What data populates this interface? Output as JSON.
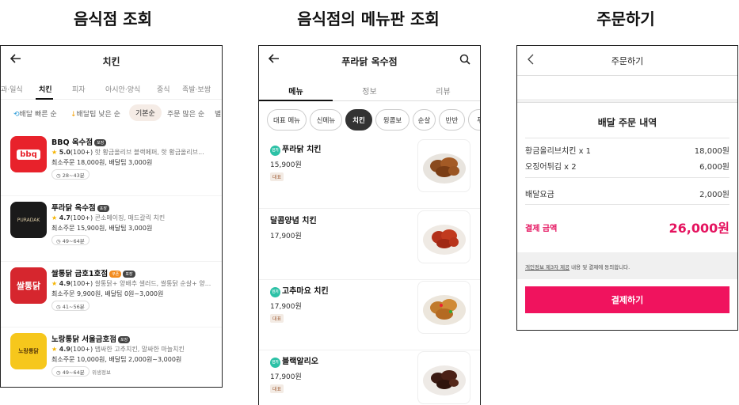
{
  "headings": {
    "search": "음식점 조회",
    "menu": "음식점의 메뉴판 조회",
    "order": "주문하기"
  },
  "search_panel": {
    "back_icon": "back-arrow-icon",
    "title": "치킨",
    "categories": [
      "과·일식",
      "치킨",
      "피자",
      "아시안·양식",
      "중식",
      "족발·보쌈"
    ],
    "active_category": "치킨",
    "sorts": [
      "배달 빠른 순",
      "배달팁 낮은 순",
      "기본순",
      "주문 많은 순",
      "별"
    ],
    "active_sort": "기본순",
    "stores": [
      {
        "name": "BBQ 옥수점",
        "tags": [
          "포장"
        ],
        "rating": "5.0",
        "reviews": "(100+)",
        "desc": "핫 황금올리브 블랙페퍼, 핫 황금올리브...",
        "min_order": "최소주문 18,000원, 배달팁 3,000원",
        "time": "28~43분",
        "logo_text": "bbq"
      },
      {
        "name": "푸라닭 옥수점",
        "tags": [
          "포장"
        ],
        "rating": "4.7",
        "reviews": "(100+)",
        "desc": "콘소메이징, 매드갈릭 치킨",
        "min_order": "최소주문 15,900원, 배달팁 3,000원",
        "time": "49~64분",
        "logo_text": "PURADAK"
      },
      {
        "name": "쌀통닭 금호1호점",
        "tags": [
          "쿠폰",
          "포장"
        ],
        "rating": "4.9",
        "reviews": "(100+)",
        "desc": "쌀통닭+ 양배추 샐러드, 쌀통닭 순살+ 양...",
        "min_order": "최소주문 9,900원, 배달팁 0원~3,000원",
        "time": "41~56분",
        "logo_text": "쌀통닭"
      },
      {
        "name": "노랑통닭 서울금호점",
        "tags": [
          "포장"
        ],
        "rating": "4.9",
        "reviews": "(100+)",
        "desc": "맵싸한 고추치킨, 말싸한 마늘치킨",
        "min_order": "최소주문 10,000원, 배달팁 2,000원~3,000원",
        "time": "49~64분",
        "extra": "위생정보",
        "logo_text": "노랑통닭"
      }
    ],
    "colors": {
      "accent": "#f5b400",
      "active_sort_bg": "#f5ece6"
    }
  },
  "menu_panel": {
    "title": "푸라닭 옥수점",
    "tabs": [
      "메뉴",
      "정보",
      "리뷰"
    ],
    "active_tab": "메뉴",
    "chips": [
      "대표 메뉴",
      "신메뉴",
      "치킨",
      "윙콤보",
      "순살",
      "반반",
      "푸"
    ],
    "active_chip": "치킨",
    "popular_label": "인기",
    "items": [
      {
        "name": "푸라닭 치킨",
        "price": "15,900원",
        "badge": "대표",
        "popular": true
      },
      {
        "name": "달콤양념 치킨",
        "price": "17,900원",
        "badge": "",
        "popular": false
      },
      {
        "name": "고추마요 치킨",
        "price": "17,900원",
        "badge": "대표",
        "popular": true
      },
      {
        "name": "블랙알리오",
        "price": "17,900원",
        "badge": "대표",
        "popular": true
      }
    ]
  },
  "order_panel": {
    "title": "주문하기",
    "summary_title": "배달 주문 내역",
    "items": [
      {
        "name": "황금올리브치킨 x 1",
        "price": "18,000원"
      },
      {
        "name": "오징어튀김 x 2",
        "price": "6,000원"
      }
    ],
    "delivery_fee_label": "배달요금",
    "delivery_fee": "2,000원",
    "total_label": "결제 금액",
    "total": "26,000원",
    "consent_link": "개인정보 제3자 제공",
    "consent_text": " 내용 및 결제에 동의합니다.",
    "pay_button": "결제하기",
    "colors": {
      "primary": "#f0135e"
    }
  }
}
